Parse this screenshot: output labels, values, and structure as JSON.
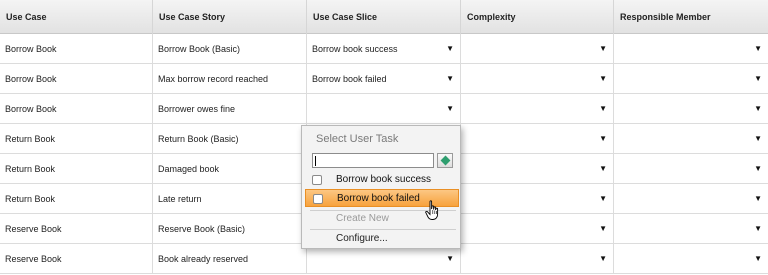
{
  "table": {
    "headers": [
      "Use Case",
      "Use Case Story",
      "Use Case Slice",
      "Complexity",
      "Responsible Member"
    ],
    "rows": [
      {
        "use_case": "Borrow Book",
        "story": "Borrow Book (Basic)",
        "slice": "Borrow book success",
        "complexity": "",
        "member": ""
      },
      {
        "use_case": "Borrow Book",
        "story": "Max borrow record reached",
        "slice": "Borrow book failed",
        "complexity": "",
        "member": ""
      },
      {
        "use_case": "Borrow Book",
        "story": "Borrower owes fine",
        "slice": "",
        "complexity": "",
        "member": ""
      },
      {
        "use_case": "Return Book",
        "story": "Return Book (Basic)",
        "slice": "",
        "complexity": "",
        "member": ""
      },
      {
        "use_case": "Return Book",
        "story": "Damaged book",
        "slice": "",
        "complexity": "",
        "member": ""
      },
      {
        "use_case": "Return Book",
        "story": "Late return",
        "slice": "",
        "complexity": "",
        "member": ""
      },
      {
        "use_case": "Reserve Book",
        "story": "Reserve Book (Basic)",
        "slice": "",
        "complexity": "",
        "member": ""
      },
      {
        "use_case": "Reserve Book",
        "story": "Book already reserved",
        "slice": "",
        "complexity": "",
        "member": ""
      }
    ],
    "dropdown_arrow": "▼"
  },
  "popup": {
    "title": "Select User Task",
    "search_value": "",
    "search_icon": "green-gem-icon",
    "options": [
      {
        "label": "Borrow book success",
        "checked": false,
        "highlighted": false
      },
      {
        "label": "Borrow book failed",
        "checked": false,
        "highlighted": true
      }
    ],
    "create_new": "Create New",
    "configure": "Configure..."
  },
  "colors": {
    "highlight_top": "#fcc784",
    "highlight_bottom": "#f7a23d",
    "header_bg": "#e8e8e8",
    "gem": "#2e9e6f"
  }
}
